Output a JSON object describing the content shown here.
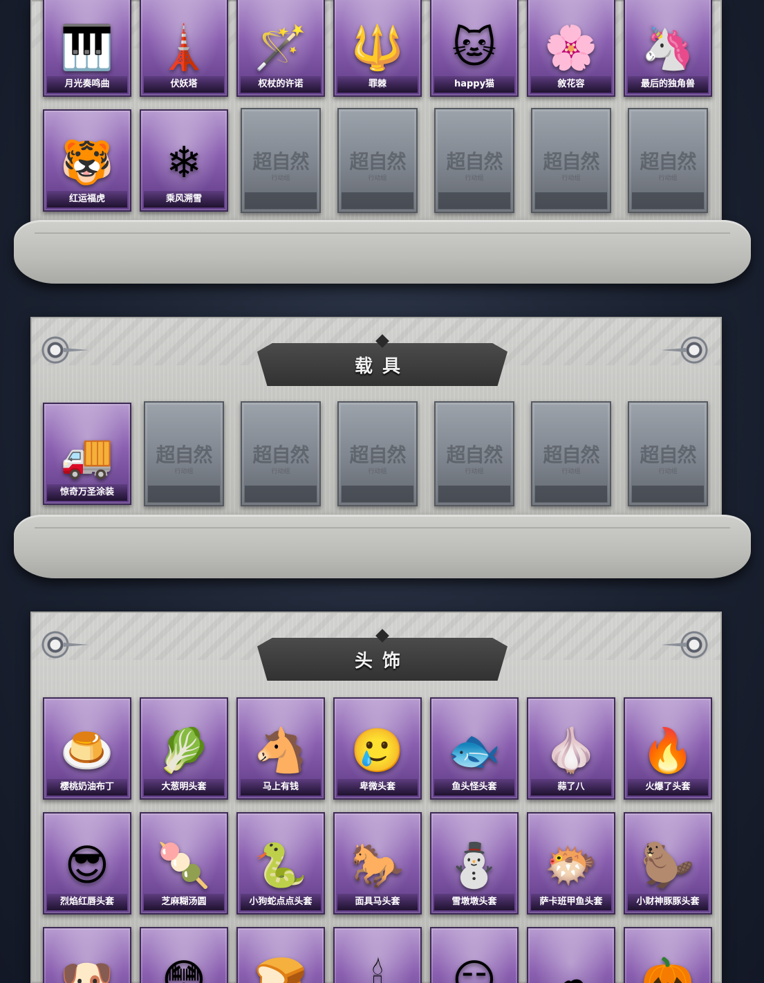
{
  "section_weapons": {
    "row1": [
      {
        "label": "月光奏鸣曲",
        "icon": "piano-moon-icon",
        "glyph": "🎹"
      },
      {
        "label": "伏妖塔",
        "icon": "pagoda-icon",
        "glyph": "🗼"
      },
      {
        "label": "权杖的许诺",
        "icon": "scepter-icon",
        "glyph": "🪄"
      },
      {
        "label": "罪棘",
        "icon": "spear-icon",
        "glyph": "🔱"
      },
      {
        "label": "happy猫",
        "icon": "cat-figure-icon",
        "glyph": "🐱"
      },
      {
        "label": "敘花容",
        "icon": "flower-hairpin-icon",
        "glyph": "🌸"
      },
      {
        "label": "最后的独角兽",
        "icon": "unicorn-horn-icon",
        "glyph": "🦄"
      }
    ],
    "row2": [
      {
        "label": "红运福虎",
        "icon": "tiger-icon",
        "glyph": "🐯"
      },
      {
        "label": "乘风溯雪",
        "icon": "snow-jetpack-icon",
        "glyph": "❄"
      }
    ],
    "empty_watermark": "超自然",
    "empty_sub": "行动组",
    "empty_count": 5
  },
  "section_vehicles": {
    "title": "载具",
    "items": [
      {
        "label": "惊奇万圣涂装",
        "icon": "halloween-truck-icon",
        "glyph": "🚚"
      }
    ],
    "empty_watermark": "超自然",
    "empty_sub": "行动组",
    "empty_count": 6
  },
  "section_headwear": {
    "title": "头饰",
    "row1": [
      {
        "label": "樱桃奶油布丁",
        "icon": "pudding-head-icon",
        "glyph": "🍮"
      },
      {
        "label": "大葱明头套",
        "icon": "scallion-head-icon",
        "glyph": "🥬"
      },
      {
        "label": "马上有钱",
        "icon": "horse-head-icon",
        "glyph": "🐴"
      },
      {
        "label": "卑微头套",
        "icon": "sad-face-head-icon",
        "glyph": "🥲"
      },
      {
        "label": "鱼头怪头套",
        "icon": "fish-head-icon",
        "glyph": "🐟"
      },
      {
        "label": "蒜了八",
        "icon": "garlic-head-icon",
        "glyph": "🧄"
      },
      {
        "label": "火爆了头套",
        "icon": "fire-head-icon",
        "glyph": "🔥"
      }
    ],
    "row2": [
      {
        "label": "烈焰红唇头套",
        "icon": "pikachu-sunglasses-icon",
        "glyph": "😎"
      },
      {
        "label": "芝麻糊汤圆",
        "icon": "rice-ball-head-icon",
        "glyph": "🍡"
      },
      {
        "label": "小狗蛇点点头套",
        "icon": "snake-head-icon",
        "glyph": "🐍"
      },
      {
        "label": "面具马头套",
        "icon": "horse-mask-icon",
        "glyph": "🐎"
      },
      {
        "label": "雪墩墩头套",
        "icon": "snowman-head-icon",
        "glyph": "⛄"
      },
      {
        "label": "萨卡班甲鱼头套",
        "icon": "armored-fish-icon",
        "glyph": "🐡"
      },
      {
        "label": "小财神豚豚头套",
        "icon": "capybara-head-icon",
        "glyph": "🦫"
      }
    ],
    "row3": [
      {
        "icon": "doge-sunglasses-icon",
        "glyph": "🐶"
      },
      {
        "icon": "googly-eyes-head-icon",
        "glyph": "😳"
      },
      {
        "icon": "toast-monster-icon",
        "glyph": "🍞"
      },
      {
        "icon": "candle-head-icon",
        "glyph": "🕯"
      },
      {
        "icon": "smirk-face-head-icon",
        "glyph": "😏"
      },
      {
        "icon": "cloud-head-icon",
        "glyph": "☁"
      },
      {
        "icon": "pumpkin-head-icon",
        "glyph": "🎃"
      }
    ]
  }
}
